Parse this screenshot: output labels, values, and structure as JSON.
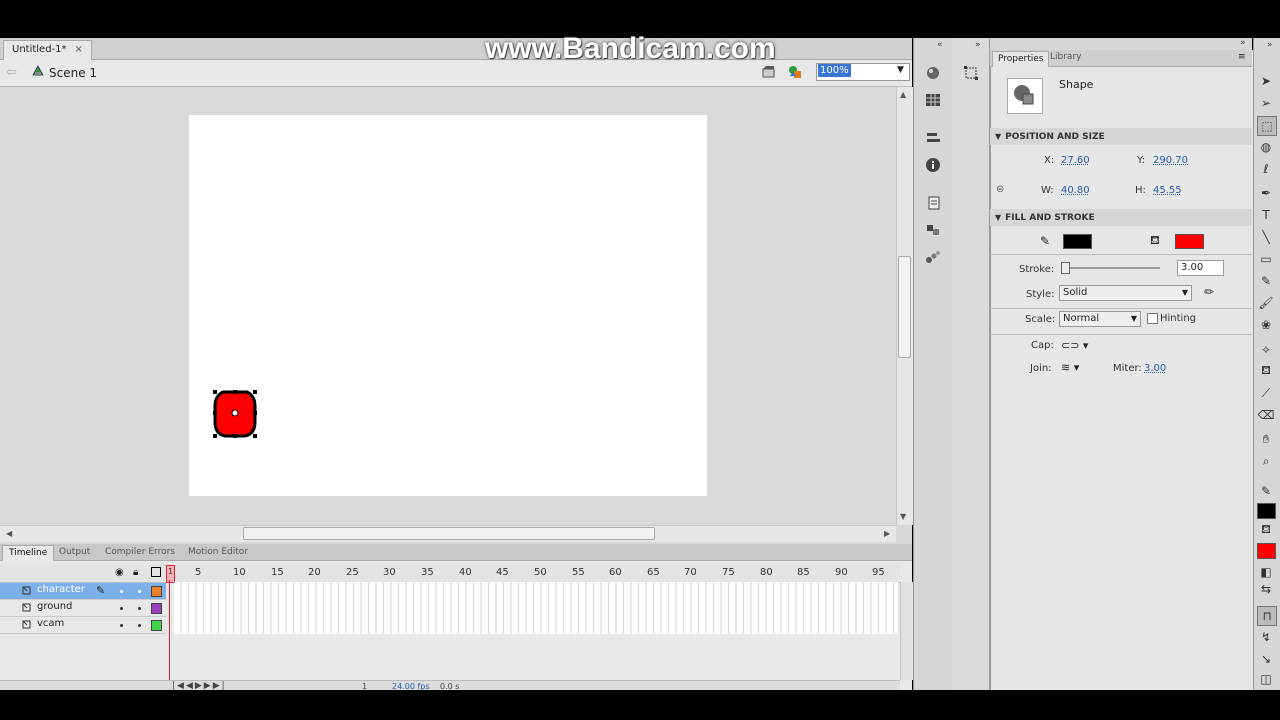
{
  "watermark": "www.Bandicam.com",
  "document": {
    "tab_title": "Untitled-1*",
    "close_glyph": "×",
    "scene": "Scene 1",
    "zoom": "100%"
  },
  "timeline": {
    "tabs": [
      "Timeline",
      "Output",
      "Compiler Errors",
      "Motion Editor"
    ],
    "frame_numbers": [
      "1",
      "5",
      "10",
      "15",
      "20",
      "25",
      "30",
      "35",
      "40",
      "45",
      "50",
      "55",
      "60",
      "65",
      "70",
      "75",
      "80",
      "85",
      "90",
      "95"
    ],
    "layers": [
      {
        "name": "character",
        "color": "#e9802a",
        "selected": true
      },
      {
        "name": "ground",
        "color": "#9b3fc1",
        "selected": false
      },
      {
        "name": "vcam",
        "color": "#3fd44a",
        "selected": false
      }
    ],
    "footer": {
      "frame": "1",
      "fps": "24.00 fps",
      "time": "0.0 s"
    }
  },
  "properties": {
    "tabs": [
      "Properties",
      "Library"
    ],
    "object_type": "Shape",
    "position_size": {
      "header": "POSITION AND SIZE",
      "x_label": "X:",
      "x": "27.60",
      "y_label": "Y:",
      "y": "290.70",
      "w_label": "W:",
      "w": "40.80",
      "h_label": "H:",
      "h": "45.55"
    },
    "fill_stroke": {
      "header": "FILL AND STROKE",
      "stroke_color": "#000000",
      "fill_color": "#ff0000",
      "stroke_label": "Stroke:",
      "stroke_value": "3.00",
      "style_label": "Style:",
      "style_value": "Solid",
      "scale_label": "Scale:",
      "scale_value": "Normal",
      "hinting_label": "Hinting",
      "cap_label": "Cap:",
      "join_label": "Join:",
      "miter_label": "Miter:",
      "miter_value": "3.00"
    }
  },
  "colors": {
    "selection_blue": "#7db0e8",
    "shape_fill": "#ff0000",
    "playhead_red": "#dd2233"
  }
}
